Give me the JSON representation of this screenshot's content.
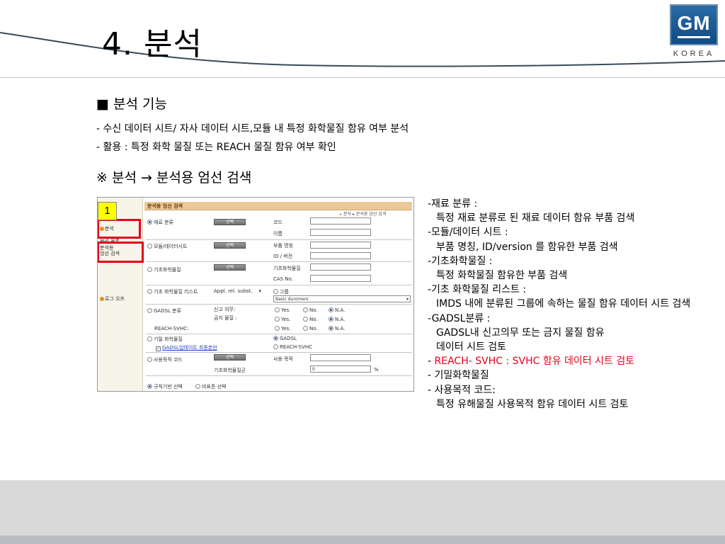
{
  "slide": {
    "title": "4. 분석",
    "logo": {
      "brand": "GM",
      "sub": "KOREA",
      "color": "#1a5a99"
    }
  },
  "section": {
    "heading": "■ 분석 기능",
    "bullets": [
      "- 수신 데이터 시트/ 자사 데이터 시트,모듈 내 특정 화학물질 함유 여부 분석",
      "- 활용 : 특정 화학 물질 또는 REACH 물질 함유 여부 확인"
    ],
    "subheading": "※ 분석 → 분석용 엄선 검색"
  },
  "screenshot": {
    "badge": "1",
    "sidebar": {
      "items": [
        "분석",
        "분석 목록",
        "분석용",
        "엄선 검색",
        "로그 오프"
      ]
    },
    "header_title": "분석용 엄선 검색",
    "breadcrumb": "분석 ▸ 분석용 엄선 검색",
    "select_label": "선택",
    "rows": {
      "material": {
        "radio": "재료 분류",
        "code": "코드",
        "name": "이름"
      },
      "module": {
        "radio": "모듈/데이터시트",
        "part_name": "부품 명칭",
        "id_version": "ID / 버전"
      },
      "basic": {
        "radio": "기초화학물질",
        "basic_field": "기초화학물질",
        "cas": "CAS No."
      },
      "list": {
        "radio": "기초 화학물질 리스트",
        "dropdown": "Appl. rel. subst.",
        "group": "그룹",
        "group_value": "Basic duromers"
      },
      "gadsl": {
        "radio": "GADSL 분류",
        "declare": "신고 의무:",
        "prohibit": "금지 물질 :",
        "reach": "REACH-SVHC:",
        "yes": "Yes.",
        "no": "No.",
        "na": "N.A."
      },
      "confidential": {
        "radio": "기밀 화학물질",
        "opt_gadsl": "GADSL",
        "opt_reach": "REACH-SVHC",
        "update_link": "GADSL업데이트 최종본만"
      },
      "usage": {
        "radio": "사용목적 코드",
        "usage_field": "사용 목적",
        "base_field": "기초화학물질군",
        "value": "0",
        "unit": "%"
      }
    },
    "footer": {
      "rule_based": "규칙기반 선택",
      "non_standard": "비표준 선택"
    }
  },
  "description": [
    {
      "text": "-재료 분류 :",
      "indent": false,
      "red": false
    },
    {
      "text": "특정 재료 분류로 된 재료 데이터 함유 부품 검색",
      "indent": true,
      "red": false
    },
    {
      "text": "-모듈/데이터 시트 :",
      "indent": false,
      "red": false
    },
    {
      "text": "부품 명칭, ID/version 를 함유한 부품 검색",
      "indent": true,
      "red": false
    },
    {
      "text": "-기초화학물질 :",
      "indent": false,
      "red": false
    },
    {
      "text": "특정 화학물질 함유한 부품 검색",
      "indent": true,
      "red": false
    },
    {
      "text": "-기초 화학물질 리스트 :",
      "indent": false,
      "red": false
    },
    {
      "text": "IMDS 내에 분류된 그룹에 속하는 물질 함유 데이터 시트 검색",
      "indent": true,
      "red": false,
      "wrap": true
    },
    {
      "text": "-GADSL분류 :",
      "indent": false,
      "red": false
    },
    {
      "text": "GADSL내 신고의무 또는 금지 물질 함유",
      "indent": true,
      "red": false
    },
    {
      "text": "데이터 시트 검토",
      "indent": true,
      "red": false
    },
    {
      "text": "REACH- SVHC : SVHC 함유 데이터 시트 검토",
      "indent": false,
      "red": true,
      "prefix": "- "
    },
    {
      "text": "- 기밀화학물질",
      "indent": false,
      "red": false
    },
    {
      "text": "- 사용목적 코드:",
      "indent": false,
      "red": false
    },
    {
      "text": "특정 유해물질 사용목적 함유 데이터 시트 검토",
      "indent": true,
      "red": false
    }
  ]
}
